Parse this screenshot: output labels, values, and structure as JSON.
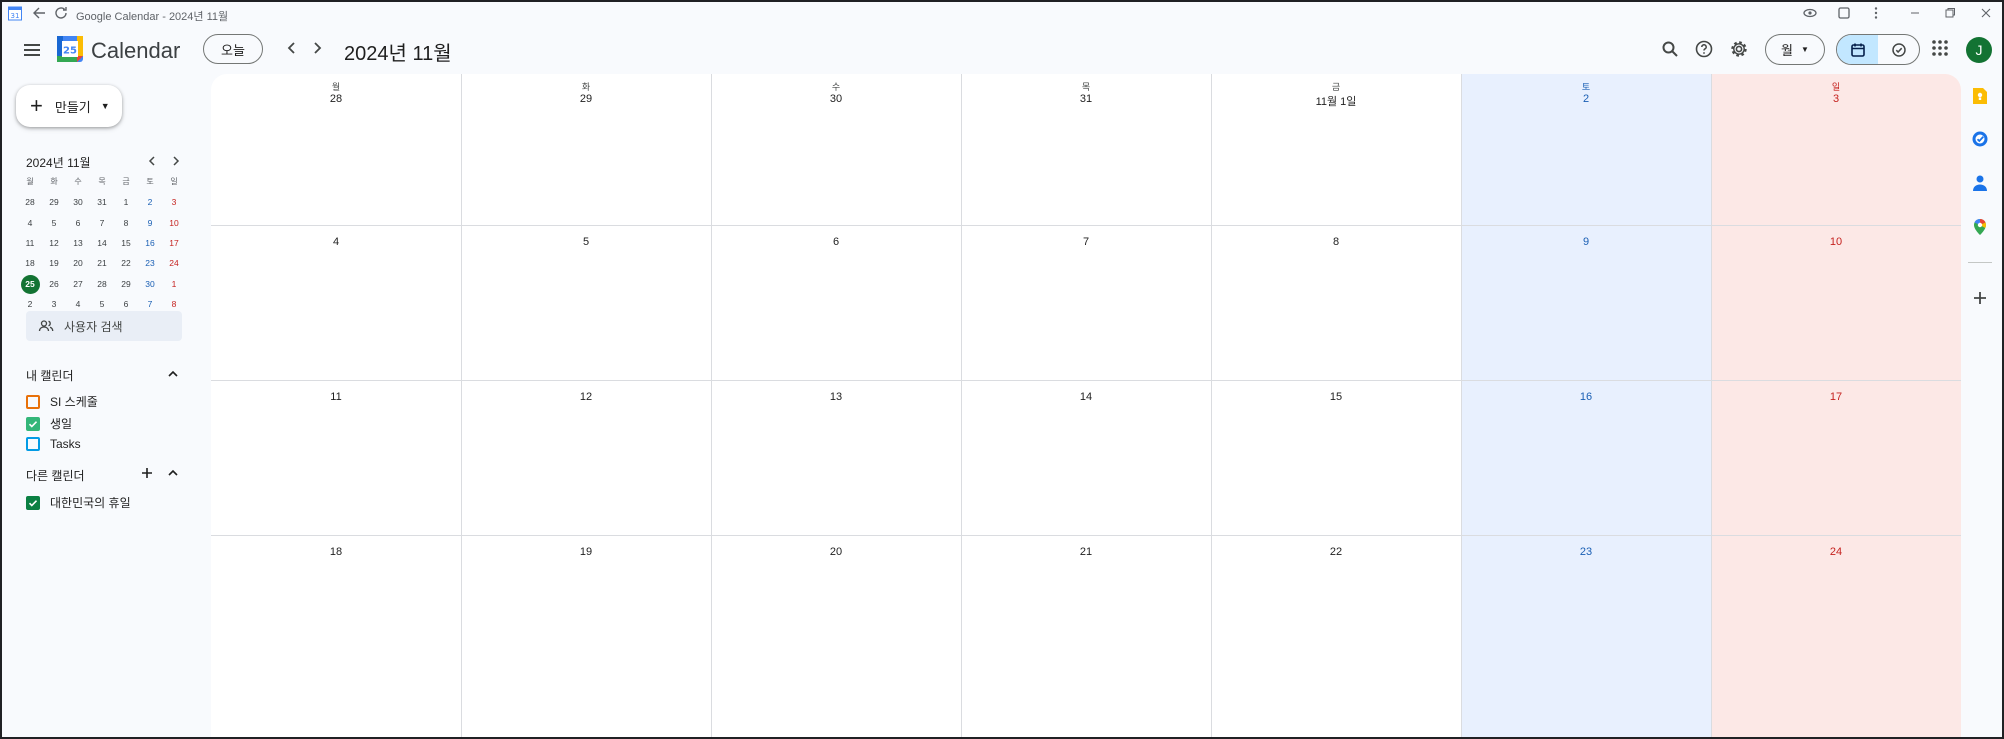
{
  "window": {
    "title": "Google Calendar - 2024년 11월"
  },
  "header": {
    "brand": "Calendar",
    "today_label": "오늘",
    "month_title": "2024년 11월",
    "view_label": "월",
    "avatar_initial": "J",
    "logo_number": "25"
  },
  "sidebar": {
    "create_label": "만들기",
    "mini_calendar": {
      "title": "2024년 11월",
      "weekdays": [
        "월",
        "화",
        "수",
        "목",
        "금",
        "토",
        "일"
      ],
      "weeks": [
        [
          "28",
          "29",
          "30",
          "31",
          "1",
          "2",
          "3"
        ],
        [
          "4",
          "5",
          "6",
          "7",
          "8",
          "9",
          "10"
        ],
        [
          "11",
          "12",
          "13",
          "14",
          "15",
          "16",
          "17"
        ],
        [
          "18",
          "19",
          "20",
          "21",
          "22",
          "23",
          "24"
        ],
        [
          "25",
          "26",
          "27",
          "28",
          "29",
          "30",
          "1"
        ],
        [
          "2",
          "3",
          "4",
          "5",
          "6",
          "7",
          "8"
        ]
      ],
      "today": "25"
    },
    "user_search_label": "사용자 검색",
    "my_calendars": {
      "heading": "내 캘린더",
      "items": [
        {
          "label": "SI 스케줄",
          "checked": false,
          "color": "#e8710a"
        },
        {
          "label": "생일",
          "checked": true,
          "color": "#33b679"
        },
        {
          "label": "Tasks",
          "checked": false,
          "color": "#039be5"
        }
      ]
    },
    "other_calendars": {
      "heading": "다른 캘린더",
      "items": [
        {
          "label": "대한민국의 휴일",
          "checked": true,
          "color": "#0b8043"
        }
      ]
    }
  },
  "month_grid": {
    "weekdays": [
      "월",
      "화",
      "수",
      "목",
      "금",
      "토",
      "일"
    ],
    "weeks": [
      [
        "28",
        "29",
        "30",
        "31",
        "11월 1일",
        "2",
        "3"
      ],
      [
        "4",
        "5",
        "6",
        "7",
        "8",
        "9",
        "10"
      ],
      [
        "11",
        "12",
        "13",
        "14",
        "15",
        "16",
        "17"
      ],
      [
        "18",
        "19",
        "20",
        "21",
        "22",
        "23",
        "24"
      ]
    ]
  },
  "colors": {
    "saturday_bg": "#e8f0fe",
    "sunday_bg": "#fce8e6",
    "saturday_text": "#1a5fb4",
    "sunday_text": "#c5221f",
    "today_circle": "#137333",
    "active_toggle": "#c2e7ff"
  },
  "icons": {
    "titlebar": [
      "calendar-app-icon",
      "back-arrow-icon",
      "reload-icon",
      "eye-icon",
      "extension-icon",
      "more-vert-icon",
      "minimize-icon",
      "restore-icon",
      "close-icon"
    ],
    "header": [
      "menu-icon",
      "search-icon",
      "help-icon",
      "settings-icon",
      "calendar-view-icon",
      "tasks-view-icon",
      "apps-grid-icon"
    ],
    "right_rail": [
      "keep-icon",
      "tasks-icon",
      "contacts-icon",
      "maps-icon",
      "add-icon"
    ]
  }
}
